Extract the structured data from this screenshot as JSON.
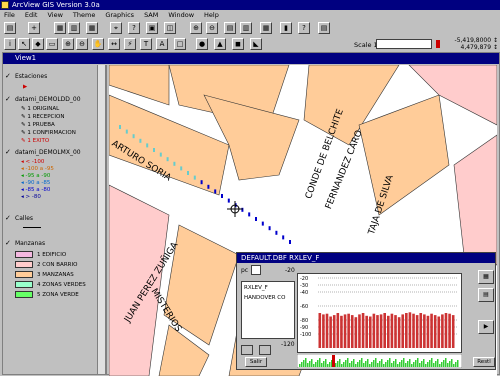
{
  "app": {
    "title": "ArcView GIS Version 3.0a"
  },
  "menu": [
    "File",
    "Edit",
    "View",
    "Theme",
    "Graphics",
    "SAM",
    "Window",
    "Help"
  ],
  "toolbar": {
    "scale_label": "Scale 1:",
    "scale_value": "",
    "coords": [
      "-5,419,8000 ↕",
      "4,479,879 ↕"
    ]
  },
  "view": {
    "title": "View1",
    "themes": [
      {
        "name": "Estaciones"
      },
      {
        "name": "datami_DEMOLDD_00"
      },
      {
        "name": "datami_DEMOLMX_00"
      },
      {
        "name": "Calles"
      },
      {
        "name": "Manzanas"
      }
    ],
    "legend_groups": [
      [
        "1 ORIGINAL",
        "1 RECEPCION",
        "1 PRUEBA",
        "1 CONFIRMACION",
        "1 EXITO"
      ],
      [
        "< -100",
        "-100 a -95",
        "-95 a -90",
        "-90 a -85",
        "-85 a -80",
        "> -80"
      ]
    ],
    "manzana_legend": [
      "1 EDIFICIO",
      "2 CON BARRIO",
      "3 MANZANAS",
      "4 ZONAS VERDES",
      "5 ZONA VERDE"
    ],
    "street_labels": [
      "ARTURO SORIA",
      "CONDE DE BELCHITE",
      "FERNANDEZ CARO",
      "TAJA DE SILVA",
      "JUAN PEREZ ZUÑIGA",
      "MISTERIOS"
    ]
  },
  "table": {
    "title": "DEFAULT.DBF  RXLEV_F",
    "fields": [
      "RXLEV_F",
      "HANDOVER CO"
    ],
    "label_left": "-20",
    "label_bottom": "-120",
    "buttons": [
      "Salir",
      "Restl"
    ]
  },
  "chart_data": {
    "type": "bar",
    "title": "",
    "xlabel": "",
    "ylabel": "",
    "ylim": [
      -120,
      -20
    ],
    "y_ticks": [
      -20,
      -30,
      -40,
      -60,
      -80,
      -90,
      -100
    ],
    "values": [
      -70,
      -72,
      -71,
      -75,
      -73,
      -70,
      -74,
      -72,
      -71,
      -73,
      -76,
      -72,
      -70,
      -74,
      -75,
      -71,
      -73,
      -72,
      -70,
      -74,
      -71,
      -73,
      -76,
      -72,
      -70,
      -69,
      -71,
      -73,
      -70,
      -72,
      -74,
      -71,
      -73,
      -75,
      -72,
      -70,
      -71,
      -73
    ]
  },
  "colors": {
    "title_bg": "#000080",
    "block": "#ffcc99",
    "block_pink": "#ffcccc",
    "bar": "#cc3333",
    "marker_blue": "#0000cc",
    "marker_cyan": "#66cccc"
  }
}
